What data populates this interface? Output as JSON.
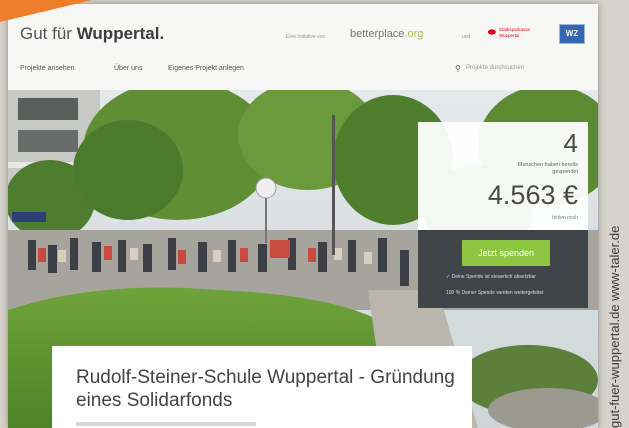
{
  "header": {
    "logo_regular": "Gut für ",
    "logo_bold": "Wuppertal.",
    "initiative": "Eine Initiative von",
    "betterplace_main": "betterplace",
    "betterplace_suffix": ".org",
    "und": "und",
    "sparkasse": "Stadtsparkasse Wuppertal",
    "wz": "WZ"
  },
  "nav": {
    "items": [
      "Projekte ansehen",
      "Über uns",
      "Eigenes Projekt anlegen"
    ],
    "search_placeholder": "Projekte durchsuchen"
  },
  "donation": {
    "donor_count": "4",
    "donor_label": "Menschen haben bereits gespendet",
    "amount": "4.563 €",
    "amount_label": "fehlen noch",
    "button": "Jetzt spenden",
    "info_1": "✓ Deine Spende ist steuerlich absetzbar",
    "info_2": "100 % Deiner Spende werden weitergeleitet"
  },
  "project": {
    "title": "Rudolf-Steiner-Schule Wuppertal - Gründung eines Solidarfonds"
  },
  "caption": "gut-fuer-wuppertal.de www-taler.de",
  "colors": {
    "accent": "#ee7d2c",
    "button": "#8ec641",
    "panel_dark": "#373e42",
    "sparkasse": "#e2001a",
    "wz": "#3566b2"
  },
  "icons": {
    "search": "search-icon"
  }
}
